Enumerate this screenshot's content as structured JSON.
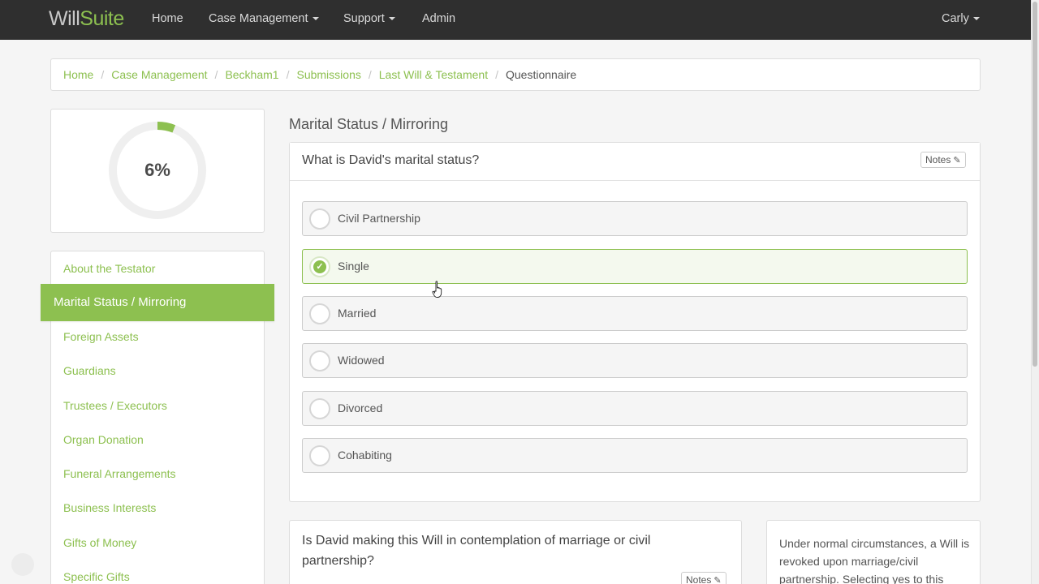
{
  "brand": {
    "part1": "Will",
    "part2": "Suite"
  },
  "nav": {
    "home": "Home",
    "case_management": "Case Management",
    "support": "Support",
    "admin": "Admin",
    "user": "Carly"
  },
  "breadcrumb": {
    "items": [
      "Home",
      "Case Management",
      "Beckham1",
      "Submissions",
      "Last Will & Testament"
    ],
    "active": "Questionnaire",
    "separator": "/"
  },
  "progress": {
    "label": "6%",
    "value": 0.06
  },
  "sidebar": {
    "items": [
      "About the Testator",
      "Marital Status / Mirroring",
      "Foreign Assets",
      "Guardians",
      "Trustees / Executors",
      "Organ Donation",
      "Funeral Arrangements",
      "Business Interests",
      "Gifts of Money",
      "Specific Gifts"
    ],
    "active_index": 1
  },
  "section_title": "Marital Status / Mirroring",
  "question1": {
    "text": "What is David's marital status?",
    "notes_label": "Notes",
    "options": [
      "Civil Partnership",
      "Single",
      "Married",
      "Widowed",
      "Divorced",
      "Cohabiting"
    ],
    "selected_index": 1
  },
  "question2": {
    "text": "Is David making this Will in contemplation of marriage or civil partnership?",
    "notes_label": "Notes"
  },
  "info": {
    "text": "Under normal circumstances, a Will is revoked upon marriage/civil partnership. Selecting yes to this"
  },
  "colors": {
    "accent": "#8dc050",
    "navbar": "#2f2f2f"
  },
  "icons": {
    "notes": "pencil-icon",
    "selected": "check-icon",
    "nav_dropdown": "caret-down-icon"
  }
}
